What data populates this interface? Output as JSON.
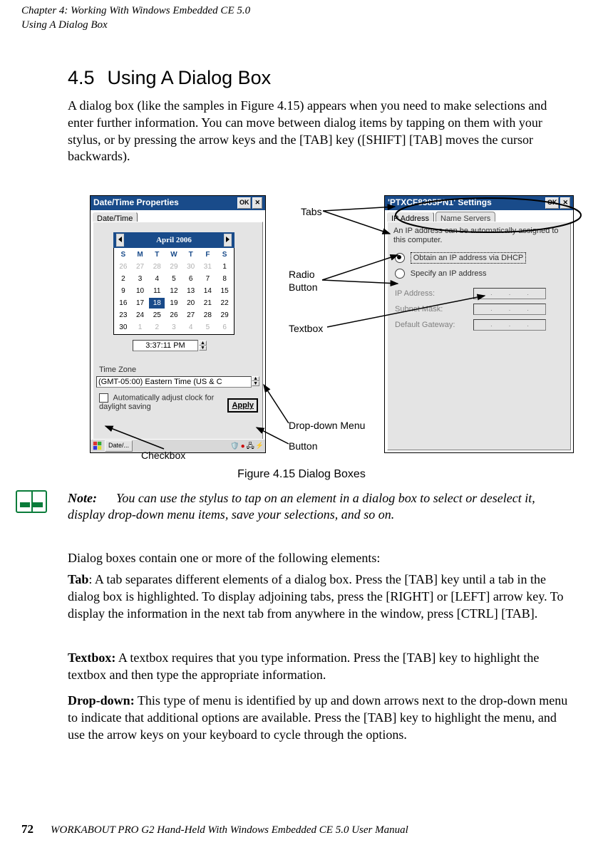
{
  "header": {
    "chapter": "Chapter 4: Working With Windows Embedded CE 5.0",
    "section": "Using A Dialog Box"
  },
  "section_title": {
    "number": "4.5",
    "text": "Using A Dialog Box"
  },
  "intro": "A dialog box (like the samples in Figure 4.15) appears when you need to make selections and enter further information. You can move between dialog items by tapping on them with your stylus, or by pressing the arrow keys and the [TAB] key ([SHIFT] [TAB] moves the cursor backwards).",
  "figure_caption": "Figure 4.15 Dialog Boxes",
  "callouts": {
    "tabs": "Tabs",
    "radio": "Radio",
    "button_lbl": "Button",
    "textbox": "Textbox",
    "dropdown": "Drop-down Menu",
    "button": "Button",
    "checkbox": "Checkbox"
  },
  "pane1": {
    "title": "Date/Time Properties",
    "ok": "OK",
    "tab1": "Date/Time",
    "month_title": "April 2006",
    "dow": [
      "S",
      "M",
      "T",
      "W",
      "T",
      "F",
      "S"
    ],
    "weeks": [
      [
        "26",
        "27",
        "28",
        "29",
        "30",
        "31",
        "1"
      ],
      [
        "2",
        "3",
        "4",
        "5",
        "6",
        "7",
        "8"
      ],
      [
        "9",
        "10",
        "11",
        "12",
        "13",
        "14",
        "15"
      ],
      [
        "16",
        "17",
        "18",
        "19",
        "20",
        "21",
        "22"
      ],
      [
        "23",
        "24",
        "25",
        "26",
        "27",
        "28",
        "29"
      ],
      [
        "30",
        "1",
        "2",
        "3",
        "4",
        "5",
        "6"
      ]
    ],
    "time": "3:37:11 PM",
    "tz_label": "Time Zone",
    "tz_value": "(GMT-05:00) Eastern Time (US & C",
    "auto_dst": "Automatically adjust clock for daylight saving",
    "apply": "Apply",
    "taskbar_item": "Date/..."
  },
  "pane2": {
    "title": "'PTXCF8385PN1' Settings",
    "ok": "OK",
    "tab_a": "IP Address",
    "tab_b": "Name Servers",
    "msg": "An IP address can be automatically assigned to this computer.",
    "opt1": "Obtain an IP address via DHCP",
    "opt2": "Specify an IP address",
    "f1": "IP Address:",
    "f2": "Subnet Mask:",
    "f3": "Default Gateway:"
  },
  "note_label": "Note:",
  "note_text": "You can use the stylus to tap on an element in a dialog box to select or deselect it, display drop-down menu items, save your selections, and so on.",
  "para0": "Dialog boxes contain one or more of the following elements:",
  "para1_l": "Tab",
  "para1": ": A tab separates different elements of a dialog box. Press the [TAB] key until a tab in the dialog box is highlighted. To display adjoining tabs, press the [RIGHT] or [LEFT] arrow key. To display the information in the next tab from anywhere in the window, press [CTRL] [TAB].",
  "para2_l": "Textbox:",
  "para2": " A textbox requires that you type information. Press the [TAB] key to highlight the textbox and then type the appropriate information.",
  "para3_l": "Drop-down:",
  "para3": " This type of menu is identified by up and down arrows next to the drop-down menu to indicate that additional options are available. Press the [TAB] key to highlight the menu, and use the arrow keys on your keyboard to cycle through the options.",
  "footer": {
    "page": "72",
    "text": "WORKABOUT PRO G2 Hand-Held With Windows Embedded CE 5.0 User Manual"
  }
}
